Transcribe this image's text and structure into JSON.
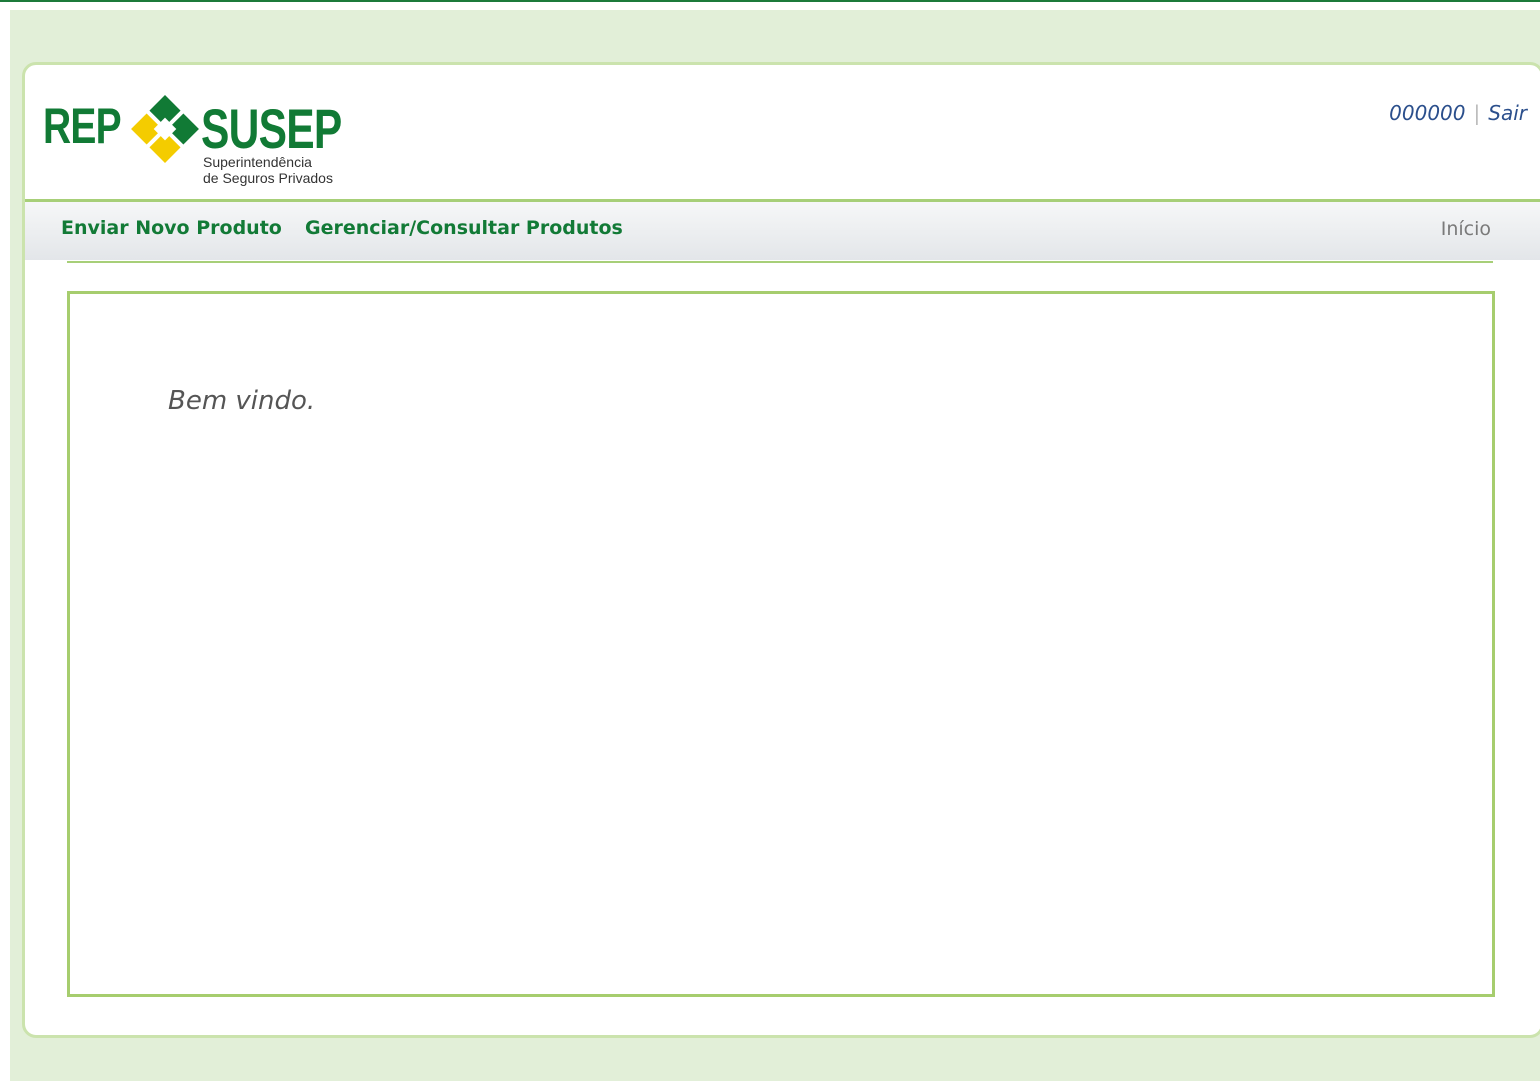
{
  "logo": {
    "rep": "REP",
    "susep": "SUSEP",
    "subtitle_line1": "Superintendência",
    "subtitle_line2": "de Seguros Privados",
    "colors": {
      "green": "#117a35",
      "yellow": "#f4cc00"
    }
  },
  "user": {
    "id": "000000",
    "separator": "|",
    "logout_label": "Sair"
  },
  "nav": {
    "items": [
      {
        "label": "Enviar Novo Produto"
      },
      {
        "label": "Gerenciar/Consultar Produtos"
      }
    ],
    "home_label": "Início"
  },
  "main": {
    "welcome_text": "Bem vindo."
  },
  "colors": {
    "page_background": "#e2efd8",
    "border_green": "#a6cd6e",
    "nav_text": "#127a36",
    "user_text": "#2b4f8c"
  }
}
